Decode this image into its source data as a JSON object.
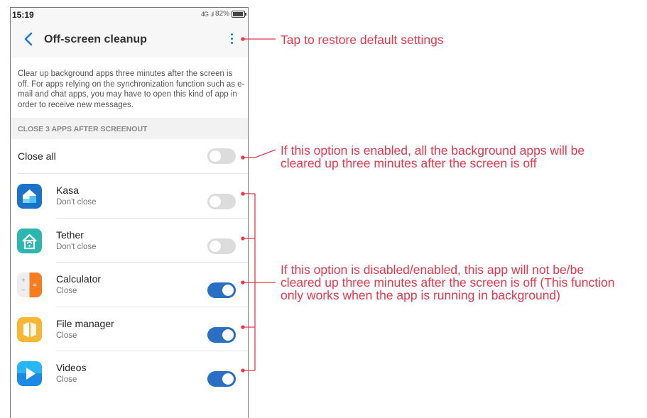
{
  "status": {
    "time": "15:19",
    "network": "4G",
    "battery": "82%"
  },
  "header": {
    "title": "Off-screen cleanup"
  },
  "description": "Clear up background apps three minutes after the screen is off. For apps relying on the synchronization function such as e-mail and chat apps, you may have to open this kind of app in order to receive new messages.",
  "section_title": "CLOSE 3 APPS AFTER SCREENOUT",
  "close_all": {
    "label": "Close all",
    "enabled": false
  },
  "apps": [
    {
      "name": "Kasa",
      "status": "Don't close",
      "enabled": false,
      "icon": "kasa-icon"
    },
    {
      "name": "Tether",
      "status": "Don't close",
      "enabled": false,
      "icon": "tether-icon"
    },
    {
      "name": "Calculator",
      "status": "Close",
      "enabled": true,
      "icon": "calculator-icon"
    },
    {
      "name": "File manager",
      "status": "Close",
      "enabled": true,
      "icon": "file-manager-icon"
    },
    {
      "name": "Videos",
      "status": "Close",
      "enabled": true,
      "icon": "videos-icon"
    }
  ],
  "annotations": {
    "menu": "Tap to restore default settings",
    "close_all_1": "If this option is enabled, all the background apps will be",
    "close_all_2": "cleared up three minutes after the screen is off",
    "apps_1": "If this option is disabled/enabled, this app will not be/be",
    "apps_2": "cleared up three minutes after the screen is off (This function",
    "apps_3": "only works when the app is running in background)"
  },
  "colors": {
    "accent": "#1b7bd4",
    "toggle_on": "#2a6fc4",
    "annotation": "#e8374b"
  }
}
